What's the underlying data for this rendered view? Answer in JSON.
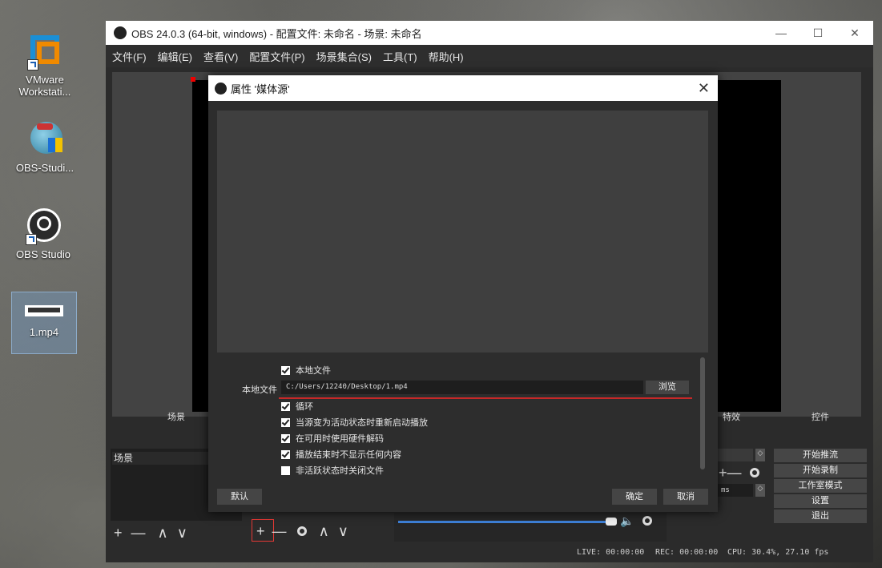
{
  "desktop": {
    "icons": [
      {
        "label": "VMware\nWorkstati..."
      },
      {
        "label": "OBS-Studi..."
      },
      {
        "label": "OBS Studio"
      },
      {
        "label": "1.mp4"
      }
    ]
  },
  "window": {
    "title": "OBS 24.0.3 (64-bit, windows) - 配置文件: 未命名 - 场景: 未命名",
    "minimize": "—",
    "maximize": "☐",
    "close": "✕"
  },
  "menu": [
    "文件(F)",
    "编辑(E)",
    "查看(V)",
    "配置文件(P)",
    "场景集合(S)",
    "工具(T)",
    "帮助(H)"
  ],
  "docks": {
    "scenes_title": "场景",
    "scene_item": "场景",
    "filters_title": "特效",
    "controls_title": "控件",
    "controls": [
      "开始推流",
      "开始录制",
      "工作室模式",
      "设置",
      "退出"
    ],
    "toolbar_glyphs": {
      "plus": "+",
      "minus": "—",
      "up": "∧",
      "down": "∨"
    },
    "duration_value": "ms"
  },
  "status_bar": {
    "live": "LIVE: 00:00:00",
    "rec": "REC: 00:00:00",
    "cpu": "CPU: 30.4%, 27.10 fps"
  },
  "dialog": {
    "title": "属性 '媒体源'",
    "close": "✕",
    "local_file_checkbox": "本地文件",
    "local_file_label": "本地文件",
    "local_file_value": "C:/Users/12240/Desktop/1.mp4",
    "browse": "浏览",
    "options": [
      {
        "label": "循环",
        "checked": true
      },
      {
        "label": "当源变为活动状态时重新启动播放",
        "checked": true
      },
      {
        "label": "在可用时使用硬件解码",
        "checked": true
      },
      {
        "label": "播放结束时不显示任何内容",
        "checked": true
      },
      {
        "label": "非活跃状态时关闭文件",
        "checked": false
      }
    ],
    "defaults": "默认",
    "ok": "确定",
    "cancel": "取消"
  }
}
